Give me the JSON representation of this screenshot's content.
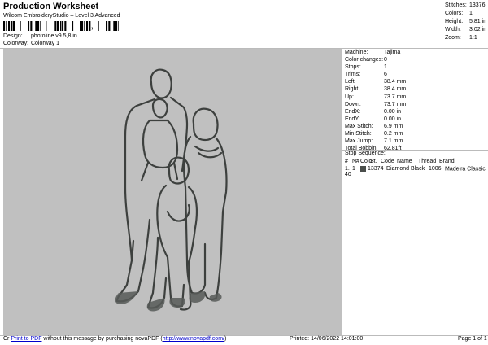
{
  "header": {
    "title": "Production Worksheet",
    "subtitle": "Wilcom EmbroideryStudio – Level 3 Advanced",
    "barcode_sep": ","
  },
  "meta": [
    {
      "label": "Design:",
      "value": "photoline v9 5,8 in"
    },
    {
      "label": "Colorway:",
      "value": "Colorway 1"
    }
  ],
  "top_stats": [
    {
      "label": "Stitches:",
      "value": "13376"
    },
    {
      "label": "Colors:",
      "value": "1"
    },
    {
      "label": "Height:",
      "value": "5.81 in"
    },
    {
      "label": "Width:",
      "value": "3.02 in"
    },
    {
      "label": "Zoom:",
      "value": "1:1"
    }
  ],
  "machine_info": [
    {
      "label": "Machine:",
      "value": "Tajima"
    },
    {
      "label": "Color changes:",
      "value": "0"
    },
    {
      "label": "Stops:",
      "value": "1"
    },
    {
      "label": "Trims:",
      "value": "6"
    },
    {
      "label": "Left:",
      "value": "38.4 mm"
    },
    {
      "label": "Right:",
      "value": "38.4 mm"
    },
    {
      "label": "Up:",
      "value": "73.7 mm"
    },
    {
      "label": "Down:",
      "value": "73.7 mm"
    },
    {
      "label": "EndX:",
      "value": "0.00 in"
    },
    {
      "label": "EndY:",
      "value": "0.00 in"
    },
    {
      "label": "Max Stitch:",
      "value": "6.9 mm"
    },
    {
      "label": "Min Stitch:",
      "value": "0.2 mm"
    },
    {
      "label": "Max Jump:",
      "value": "7.1 mm"
    },
    {
      "label": "Total Bobbin:",
      "value": "62.81ft"
    }
  ],
  "stop_sequence": {
    "title": "Stop Sequence:",
    "headers": [
      "#",
      "N#",
      "Color",
      "St.",
      "Code",
      "Name",
      "Thread",
      "Brand"
    ],
    "row": {
      "num": "1.",
      "n": "1",
      "stitches": "13374",
      "name": "Diamond Black",
      "code": "1006",
      "brand": "Madeira Classic 40"
    },
    "swatch_color": "#4a4e4b"
  },
  "footer": {
    "prefix": "Cr",
    "link1": "Print to PDF",
    "middle": " without this message by purchasing novaPDF (",
    "link2": "http://www.novapdf.com/",
    "suffix": ")",
    "printed": "Printed: 14/06/2022 14:01:00",
    "page": "Page 1 of 1"
  }
}
